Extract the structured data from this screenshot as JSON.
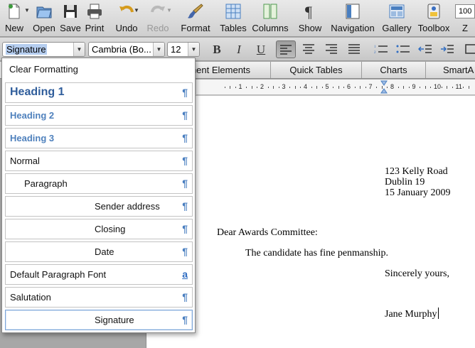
{
  "toolbar": {
    "new_label": "New",
    "open_label": "Open",
    "save_label": "Save",
    "print_label": "Print",
    "undo_label": "Undo",
    "redo_label": "Redo",
    "format_label": "Format",
    "tables_label": "Tables",
    "columns_label": "Columns",
    "show_label": "Show",
    "navigation_label": "Navigation",
    "gallery_label": "Gallery",
    "toolbox_label": "Toolbox",
    "zoom_value": "100",
    "zoom_label": "Z"
  },
  "formatting": {
    "style_value": "Signature",
    "font_value": "Cambria (Bo...",
    "size_value": "12",
    "bold": "B",
    "italic": "I",
    "underline": "U"
  },
  "elements_tabs": [
    {
      "label": "nent Elements"
    },
    {
      "label": "Quick Tables"
    },
    {
      "label": "Charts"
    },
    {
      "label": "SmartA"
    }
  ],
  "ruler_numbers": [
    "1",
    "2",
    "3",
    "4",
    "5",
    "6",
    "7",
    "8",
    "9",
    "10",
    "11"
  ],
  "style_menu": {
    "items": [
      {
        "label": "Clear Formatting",
        "mark": ""
      },
      {
        "label": "Heading 1",
        "mark": "¶"
      },
      {
        "label": "Heading 2",
        "mark": "¶"
      },
      {
        "label": "Heading 3",
        "mark": "¶"
      },
      {
        "label": "Normal",
        "mark": "¶"
      },
      {
        "label": "Paragraph",
        "mark": "¶"
      },
      {
        "label": "Sender address",
        "mark": "¶"
      },
      {
        "label": "Closing",
        "mark": "¶"
      },
      {
        "label": "Date",
        "mark": "¶"
      },
      {
        "label": "Default Paragraph Font",
        "mark": "a"
      },
      {
        "label": "Salutation",
        "mark": "¶"
      },
      {
        "label": "Signature",
        "mark": "¶"
      }
    ],
    "selected": "Signature"
  },
  "document": {
    "address_line1": "123 Kelly Road",
    "address_line2": "Dublin 19",
    "date": "15 January 2009",
    "salutation": "Dear Awards Committee:",
    "body": "The candidate has fine penmanship.",
    "closing": "Sincerely yours,",
    "signature": "Jane Murphy"
  },
  "colors": {
    "heading": "#2f5d9b",
    "accent": "#4f81bd",
    "selection": "#b5cdef"
  }
}
